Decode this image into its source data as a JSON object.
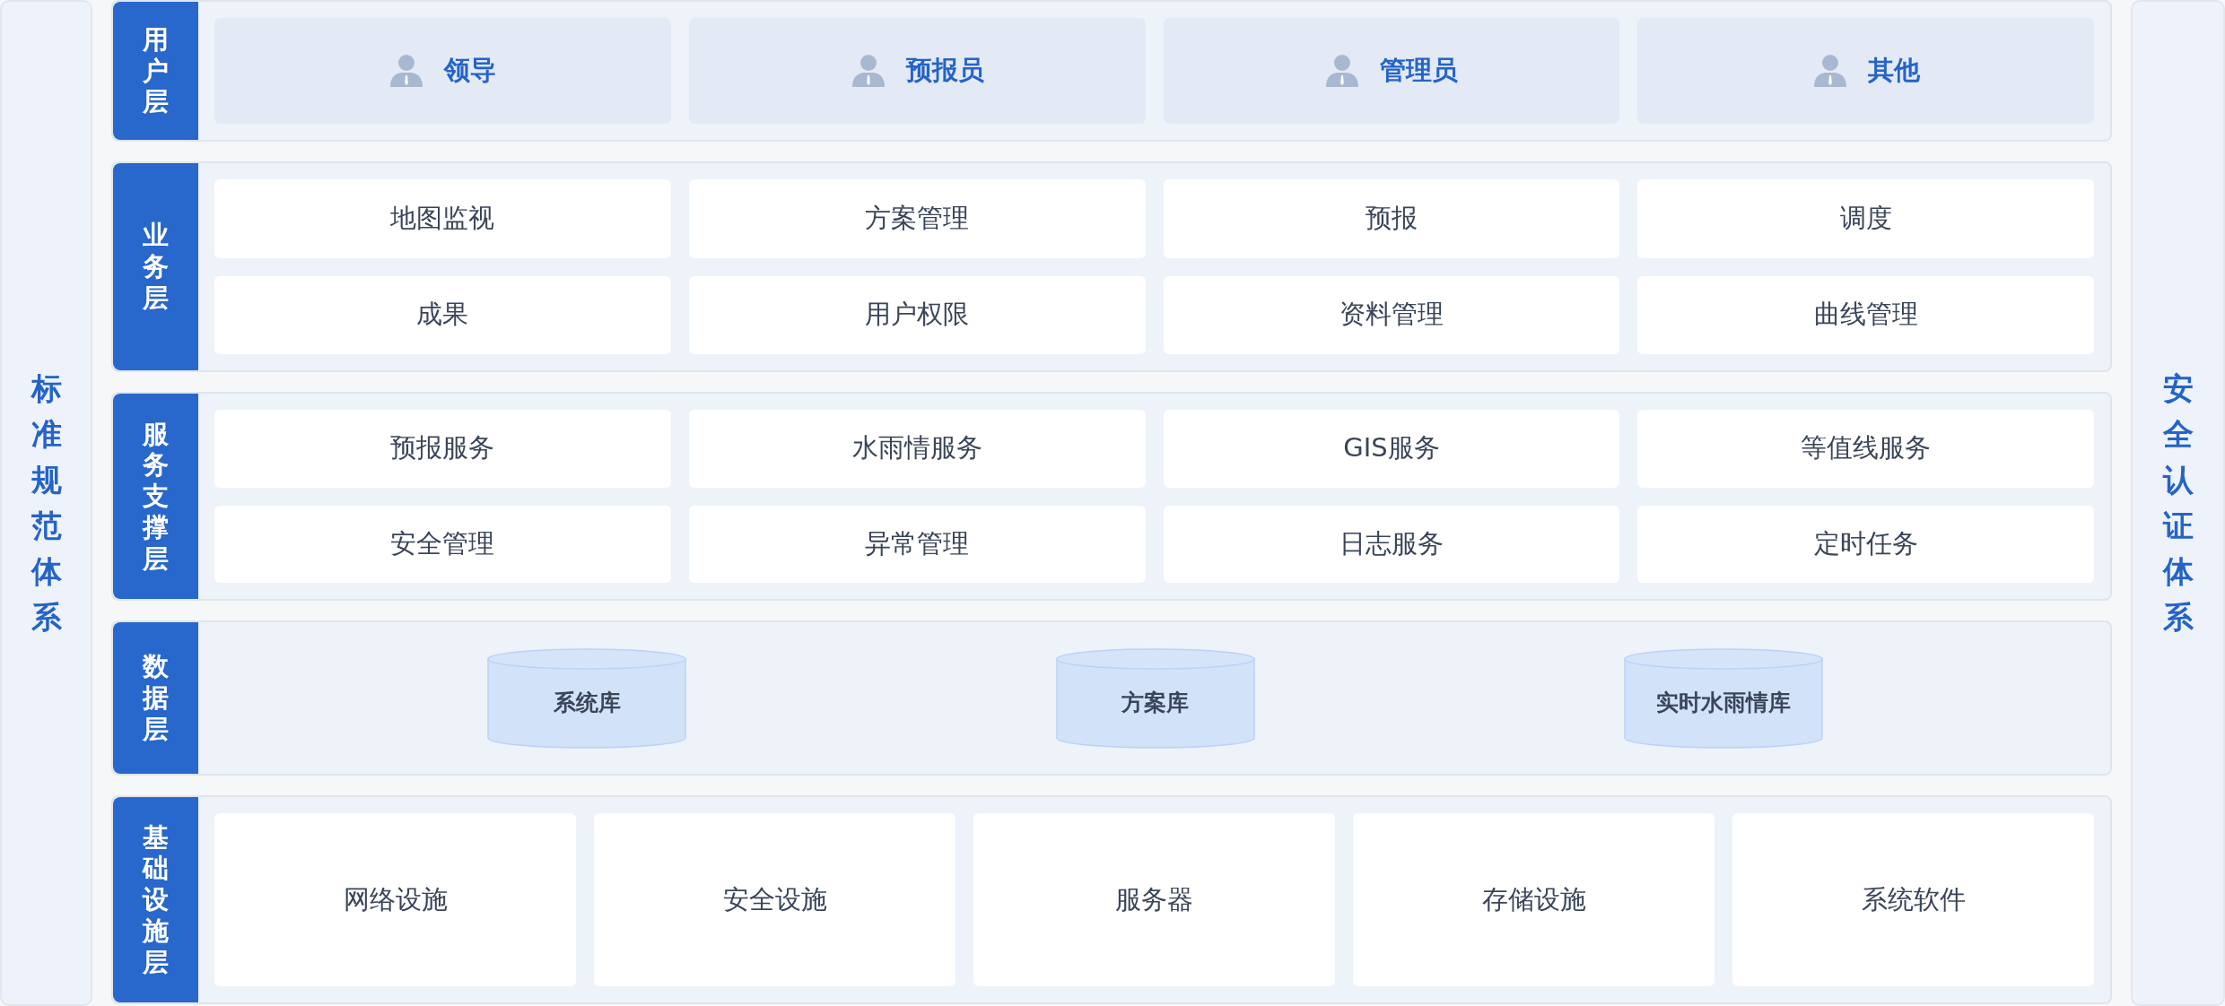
{
  "left_panel": {
    "title": "标准规范体系"
  },
  "right_panel": {
    "title": "安全认证体系"
  },
  "layers": [
    {
      "kind": "users",
      "label": "用户层",
      "items": [
        "领导",
        "预报员",
        "管理员",
        "其他"
      ]
    },
    {
      "kind": "grid",
      "label": "业务层",
      "items": [
        "地图监视",
        "方案管理",
        "预报",
        "调度",
        "成果",
        "用户权限",
        "资料管理",
        "曲线管理"
      ]
    },
    {
      "kind": "grid",
      "label": "服务支撑层",
      "items": [
        "预报服务",
        "水雨情服务",
        "GIS服务",
        "等值线服务",
        "安全管理",
        "异常管理",
        "日志服务",
        "定时任务"
      ]
    },
    {
      "kind": "databases",
      "label": "数据层",
      "items": [
        "系统库",
        "方案库",
        "实时水雨情库"
      ]
    },
    {
      "kind": "infra",
      "label": "基础设施层",
      "items": [
        "网络设施",
        "安全设施",
        "服务器",
        "存储设施",
        "系统软件"
      ]
    }
  ]
}
